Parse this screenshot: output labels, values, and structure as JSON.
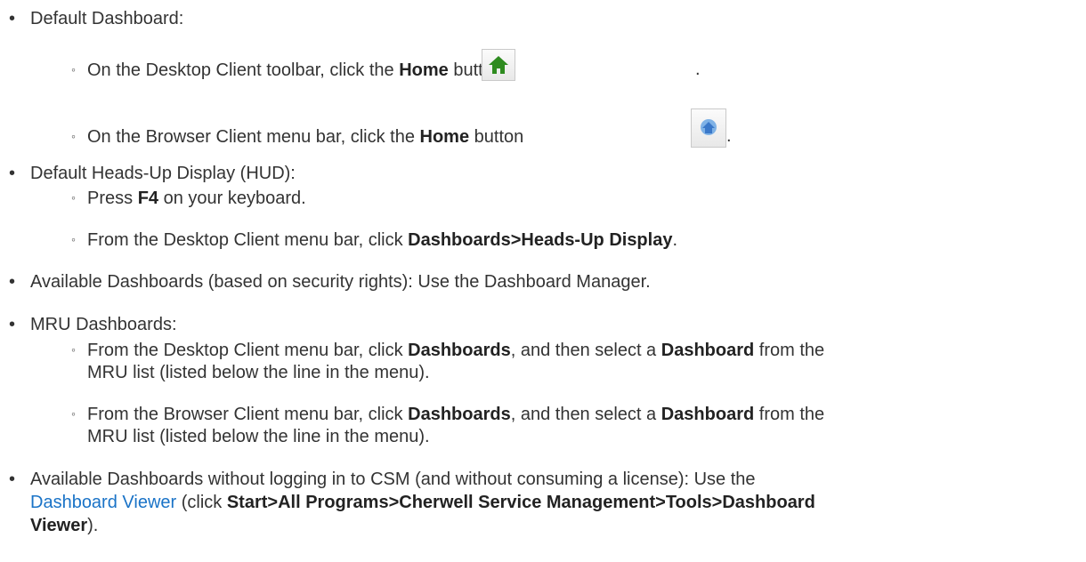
{
  "items": [
    {
      "label": "Default Dashboard:"
    },
    {
      "prefix": "On the Desktop Client toolbar, click the ",
      "bold": "Home",
      "suffix": " button",
      "end": ".",
      "icon": "home-green-icon",
      "color": "#2e8b1f"
    },
    {
      "prefix": "On the Browser Client menu bar, click the ",
      "bold": "Home",
      "suffix": " button",
      "end": ".",
      "icon": "home-blue-icon",
      "color": "#3a78c9"
    },
    {
      "label": "Default Heads-Up Display (HUD):"
    },
    {
      "prefix": "Press ",
      "bold": "F4",
      "suffix": " on your keyboard."
    },
    {
      "prefix": "From the Desktop Client menu bar, click ",
      "bold": "Dashboards>Heads-Up Display",
      "suffix": "."
    },
    {
      "label": "Available Dashboards (based on security rights): Use the Dashboard Manager."
    },
    {
      "label": "MRU Dashboards:"
    },
    {
      "line1_prefix": "From the Desktop Client menu bar, click ",
      "b1": "Dashboards",
      "mid": ", and then select a ",
      "b2": "Dashboard",
      "tail": " from the",
      "line2": "MRU list (listed below the line in the menu)."
    },
    {
      "line1_prefix": "From the Browser Client menu bar, click ",
      "b1": "Dashboards",
      "mid": ", and then select a ",
      "b2": "Dashboard",
      "tail": " from the",
      "line2": "MRU list (listed below the line in the menu)."
    },
    {
      "line1": "Available Dashboards without logging in to CSM (and without consuming a license): Use the",
      "link": "Dashboard Viewer",
      "mid": " (click ",
      "bold": "Start>All Programs>Cherwell Service Management>Tools>Dashboard",
      "bold2": "Viewer",
      "end": ")."
    }
  ]
}
